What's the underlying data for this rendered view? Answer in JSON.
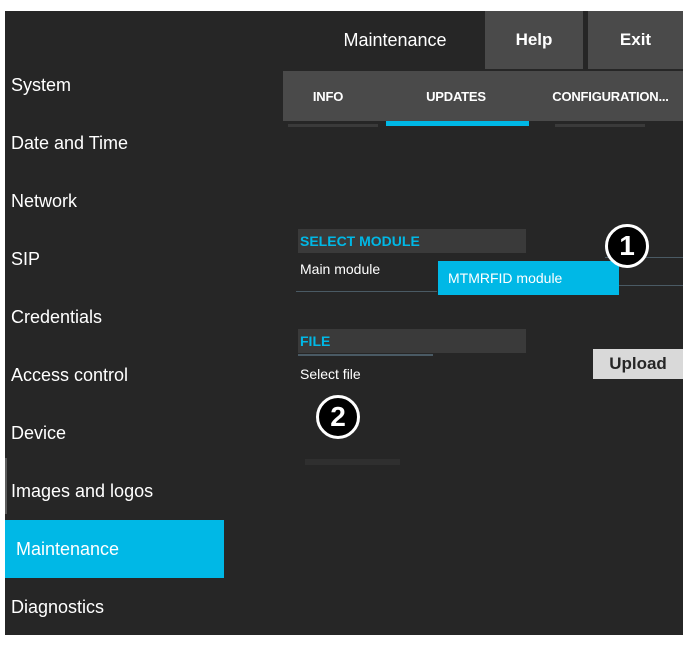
{
  "header": {
    "title": "Maintenance",
    "help_label": "Help",
    "exit_label": "Exit"
  },
  "sidebar": {
    "items": [
      {
        "label": "System"
      },
      {
        "label": "Date and Time"
      },
      {
        "label": "Network"
      },
      {
        "label": "SIP"
      },
      {
        "label": "Credentials"
      },
      {
        "label": "Access control"
      },
      {
        "label": "Device"
      },
      {
        "label": "Images and logos"
      },
      {
        "label": "Maintenance",
        "active": true
      },
      {
        "label": "Diagnostics"
      }
    ]
  },
  "tabs": [
    {
      "label": "INFO"
    },
    {
      "label": "UPDATES",
      "active": true
    },
    {
      "label": "CONFIGURATION..."
    }
  ],
  "select_module": {
    "heading": "SELECT MODULE",
    "label": "Main module",
    "option": "MTMRFID module"
  },
  "file": {
    "heading": "FILE",
    "label": "Select file",
    "upload_label": "Upload"
  },
  "annotations": {
    "marker1": "1",
    "marker2": "2"
  },
  "colors": {
    "accent": "#00b8e6",
    "background": "#262626",
    "header_button": "#4a4a4a",
    "upload_button": "#d9d9d9"
  }
}
